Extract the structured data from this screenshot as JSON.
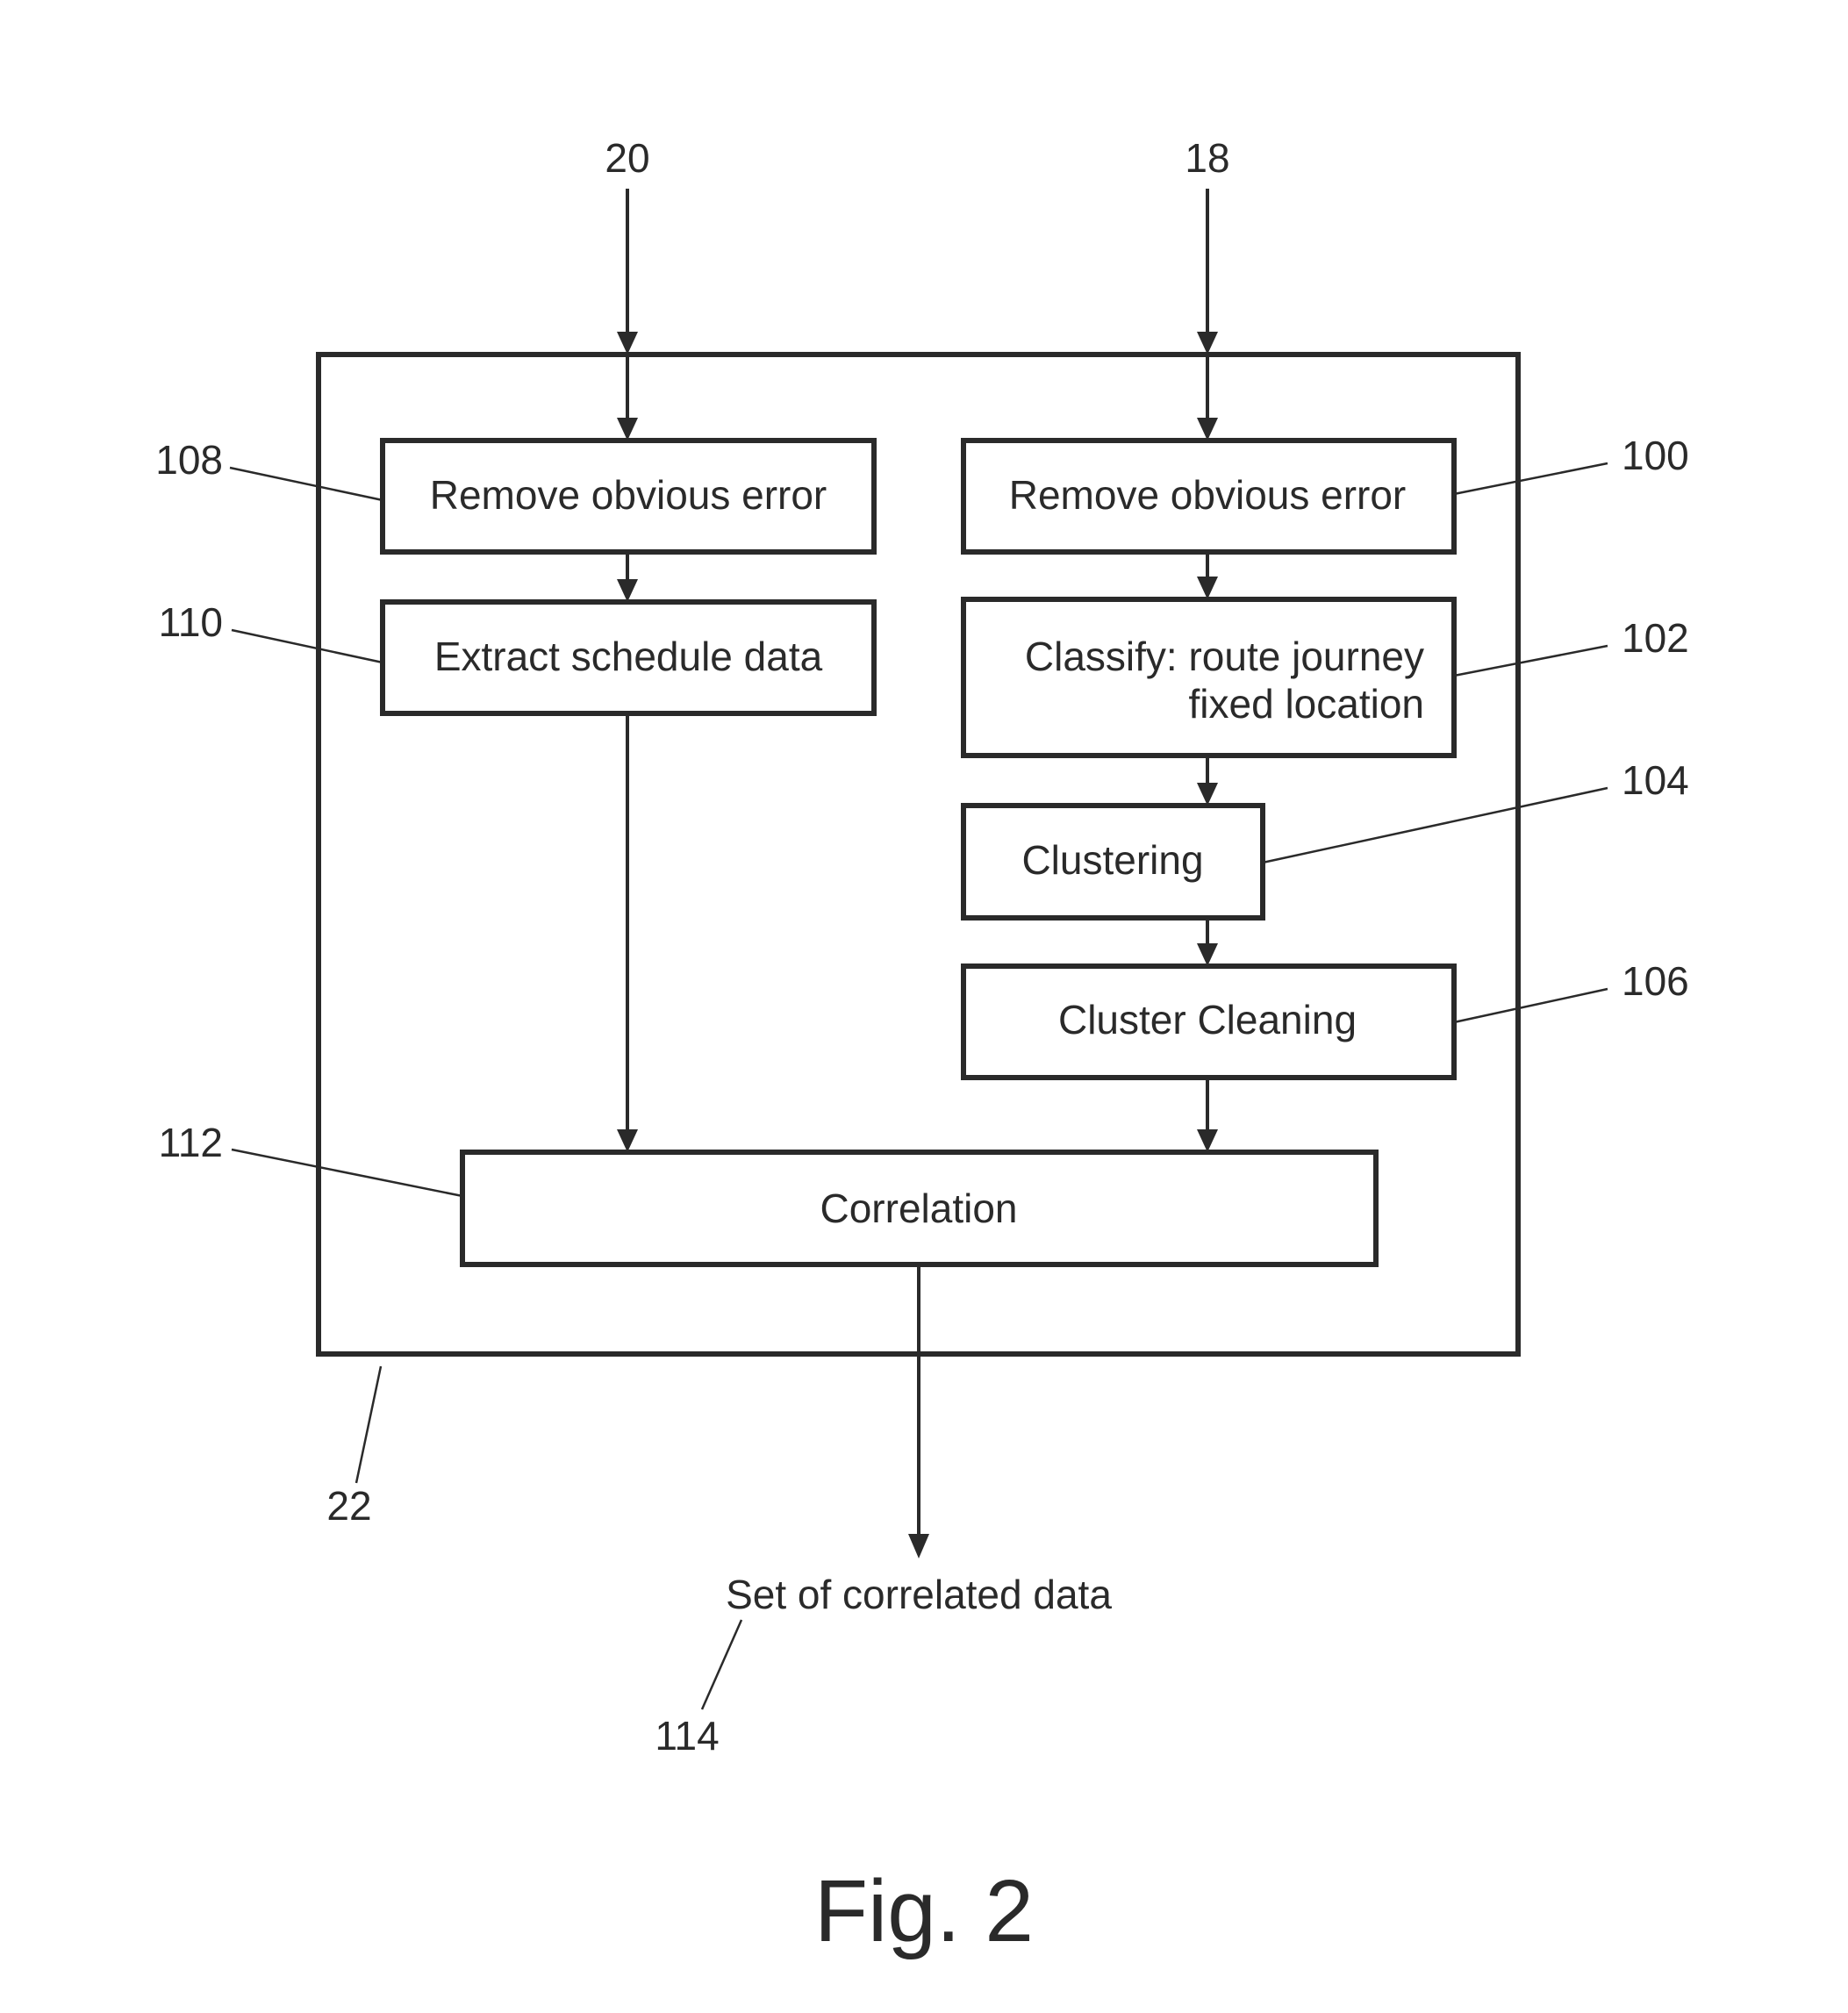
{
  "figure": {
    "caption": "Fig. 2",
    "inputs": [
      {
        "ref": "20"
      },
      {
        "ref": "18"
      }
    ],
    "container": {
      "ref": "22"
    },
    "steps": {
      "remove_error_left": {
        "ref": "108",
        "label": "Remove obvious error"
      },
      "extract_schedule": {
        "ref": "110",
        "label": "Extract schedule data"
      },
      "remove_error_right": {
        "ref": "100",
        "label": "Remove obvious error"
      },
      "classify": {
        "ref": "102",
        "lines": [
          "Classify: route journey",
          "fixed location"
        ]
      },
      "clustering": {
        "ref": "104",
        "label": "Clustering"
      },
      "cluster_cleaning": {
        "ref": "106",
        "label": "Cluster Cleaning"
      },
      "correlation": {
        "ref": "112",
        "label": "Correlation"
      }
    },
    "output": {
      "ref": "114",
      "label": "Set of correlated data"
    }
  }
}
